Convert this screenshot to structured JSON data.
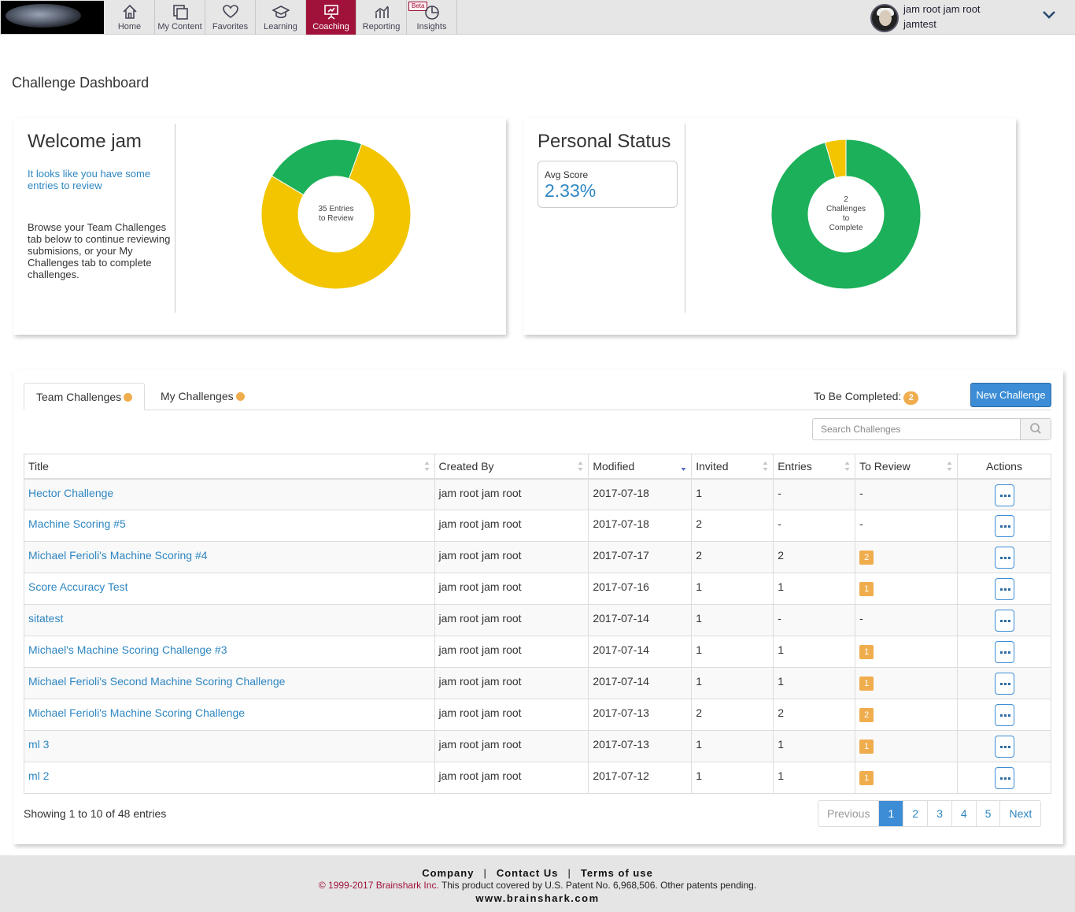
{
  "nav": {
    "items": [
      {
        "label": "Home",
        "icon": "home-icon"
      },
      {
        "label": "My Content",
        "icon": "my-content-icon"
      },
      {
        "label": "Favorites",
        "icon": "heart-icon"
      },
      {
        "label": "Learning",
        "icon": "graduation-cap-icon"
      },
      {
        "label": "Coaching",
        "icon": "presentation-icon",
        "active": true
      },
      {
        "label": "Reporting",
        "icon": "bar-chart-icon"
      },
      {
        "label": "Insights",
        "icon": "pie-chart-icon",
        "badge": "Beta"
      }
    ],
    "active_color": "#a0123a"
  },
  "user": {
    "name": "jam root jam root",
    "org": "jamtest"
  },
  "page": {
    "title": "Challenge Dashboard"
  },
  "welcome": {
    "title": "Welcome jam",
    "notice": "It looks like you have some entries to review",
    "browse": "Browse your Team Challenges tab below to continue reviewing submisions, or your My Challenges tab to complete challenges.",
    "donut_line1": "35 Entries",
    "donut_line2": "to Review"
  },
  "personal": {
    "title": "Personal Status",
    "avg_label": "Avg Score",
    "avg_value": "2.33%",
    "donut_line1": "2",
    "donut_line2": "Challenges",
    "donut_line3": "to",
    "donut_line4": "Complete"
  },
  "chart_data": [
    {
      "type": "pie",
      "slices": [
        {
          "value": 0.78,
          "color": "#f2c500"
        },
        {
          "value": 0.22,
          "color": "#1db05a"
        }
      ]
    },
    {
      "type": "pie",
      "slices": [
        {
          "value": 0.955,
          "color": "#1db05a"
        },
        {
          "value": 0.045,
          "color": "#f2c500"
        }
      ]
    }
  ],
  "tabs": {
    "team": "Team Challenges",
    "mine": "My Challenges"
  },
  "to_be_completed": {
    "label": "To Be Completed:",
    "count": "2"
  },
  "new_challenge": "New Challenge",
  "search": {
    "placeholder": "Search Challenges"
  },
  "table": {
    "headers": [
      "Title",
      "Created By",
      "Modified",
      "Invited",
      "Entries",
      "To Review",
      "Actions"
    ],
    "rows": [
      {
        "title": "Hector Challenge",
        "by": "jam root jam root",
        "modified": "2017-07-18",
        "invited": "1",
        "entries": "-",
        "review": "-"
      },
      {
        "title": "Machine Scoring #5",
        "by": "jam root jam root",
        "modified": "2017-07-18",
        "invited": "2",
        "entries": "-",
        "review": "-"
      },
      {
        "title": "Michael Ferioli's Machine Scoring #4",
        "by": "jam root jam root",
        "modified": "2017-07-17",
        "invited": "2",
        "entries": "2",
        "review": "2"
      },
      {
        "title": "Score Accuracy Test",
        "by": "jam root jam root",
        "modified": "2017-07-16",
        "invited": "1",
        "entries": "1",
        "review": "1"
      },
      {
        "title": "sitatest",
        "by": "jam root jam root",
        "modified": "2017-07-14",
        "invited": "1",
        "entries": "-",
        "review": "-"
      },
      {
        "title": "Michael's Machine Scoring Challenge #3",
        "by": "jam root jam root",
        "modified": "2017-07-14",
        "invited": "1",
        "entries": "1",
        "review": "1"
      },
      {
        "title": "Michael Ferioli's Second Machine Scoring Challenge",
        "by": "jam root jam root",
        "modified": "2017-07-14",
        "invited": "1",
        "entries": "1",
        "review": "1"
      },
      {
        "title": "Michael Ferioli's Machine Scoring Challenge",
        "by": "jam root jam root",
        "modified": "2017-07-13",
        "invited": "2",
        "entries": "2",
        "review": "2"
      },
      {
        "title": "ml 3",
        "by": "jam root jam root",
        "modified": "2017-07-13",
        "invited": "1",
        "entries": "1",
        "review": "1"
      },
      {
        "title": "ml 2",
        "by": "jam root jam root",
        "modified": "2017-07-12",
        "invited": "1",
        "entries": "1",
        "review": "1"
      }
    ]
  },
  "showing": "Showing 1 to 10 of 48 entries",
  "pager": [
    "Previous",
    "1",
    "2",
    "3",
    "4",
    "5",
    "Next"
  ],
  "footer": {
    "company": "Company",
    "contact": "Contact Us",
    "terms": "Terms of use",
    "copyright": "© 1999-2017 Brainshark Inc.",
    "patent": "This product covered by U.S. Patent No. 6,968,506. Other patents pending.",
    "web": "www.brainshark.com"
  }
}
